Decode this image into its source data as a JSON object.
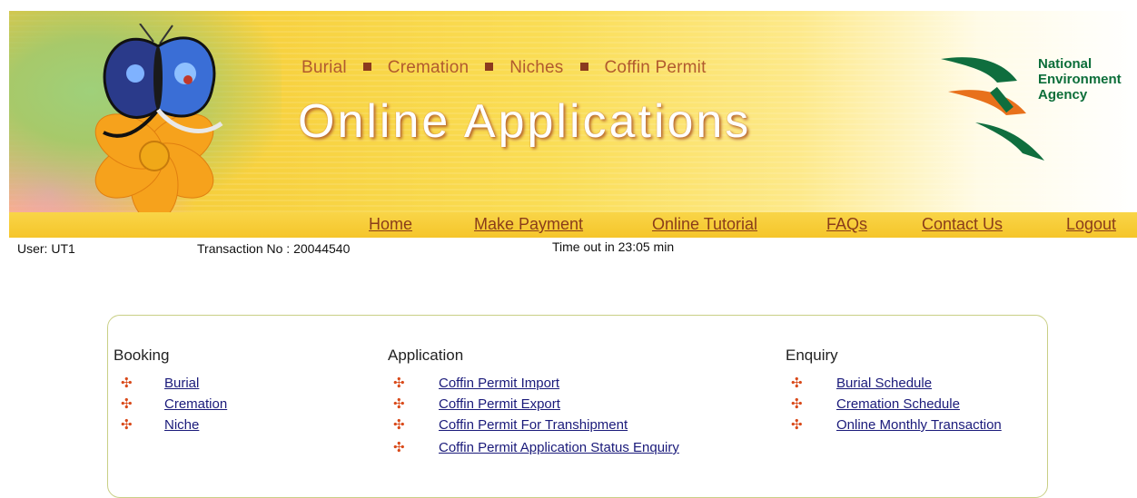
{
  "banner": {
    "categories": [
      "Burial",
      "Cremation",
      "Niches",
      "Coffin Permit"
    ],
    "title": "Online Applications",
    "agency": [
      "National",
      "Environment",
      "Agency"
    ],
    "accent_color": "#f5c52a",
    "title_color": "#ffffff",
    "category_color": "#b15a2e"
  },
  "nav": {
    "items": [
      "Home",
      "Make Payment",
      "Online Tutorial",
      "FAQs",
      "Contact Us",
      "Logout"
    ],
    "link_color": "#8a3d1a"
  },
  "status": {
    "user": "User: UT1",
    "transaction": "Transaction No : 20044540",
    "timeout": "Time out in 23:05 min"
  },
  "sections": {
    "booking": {
      "title": "Booking",
      "items": [
        "Burial",
        "Cremation",
        "Niche"
      ]
    },
    "application": {
      "title": "Application",
      "items": [
        "Coffin Permit Import",
        "Coffin Permit Export",
        "Coffin Permit For Transhipment",
        "Coffin Permit Application Status Enquiry"
      ]
    },
    "enquiry": {
      "title": "Enquiry",
      "items": [
        "Burial Schedule",
        "Cremation Schedule",
        "Online Monthly Transaction"
      ]
    }
  },
  "icons": {
    "bullet": "flower-bullet-icon",
    "logo": "nea-logo-icon"
  },
  "colors": {
    "bullet": "#d94a1a",
    "link": "#1a1a7a",
    "panel_border": "#c9cf86"
  }
}
